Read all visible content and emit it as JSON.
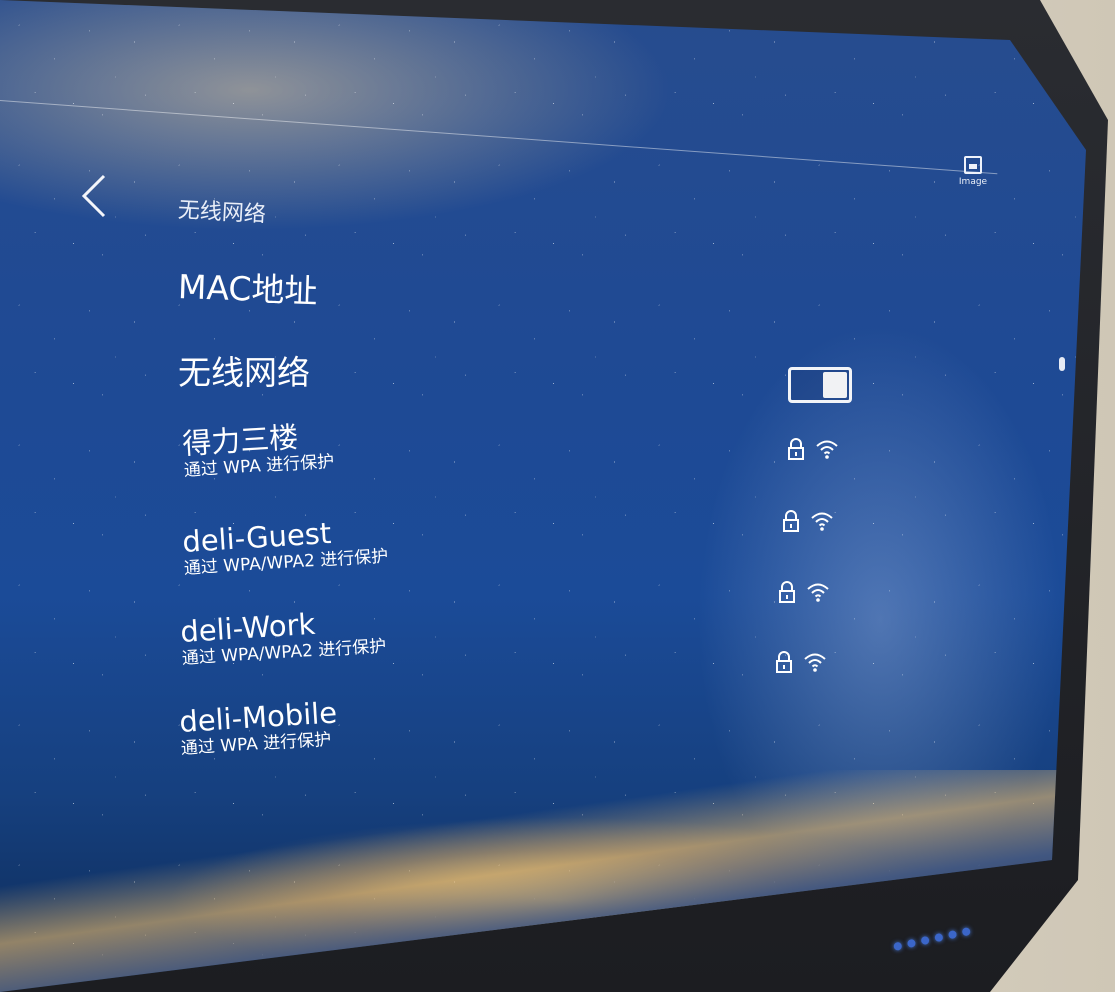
{
  "header": {
    "back_icon": "chevron-left-icon",
    "title": "无线网络",
    "widget_icon": "picture-icon",
    "widget_label": "Image"
  },
  "settings": {
    "mac_label": "MAC地址",
    "wifi_label": "无线网络",
    "wifi_enabled": true
  },
  "networks": [
    {
      "name": "得力三楼",
      "security": "通过 WPA 进行保护",
      "locked": true
    },
    {
      "name": "deli-Guest",
      "security": "通过 WPA/WPA2 进行保护",
      "locked": true
    },
    {
      "name": "deli-Work",
      "security": "通过 WPA/WPA2 进行保护",
      "locked": true
    },
    {
      "name": "deli-Mobile",
      "security": "通过 WPA 进行保护",
      "locked": false
    }
  ],
  "colors": {
    "screen_bg": "#1f4a94",
    "text": "#ffffff",
    "accent_glow": "#ffd678",
    "indicator": "#3b66c9"
  }
}
